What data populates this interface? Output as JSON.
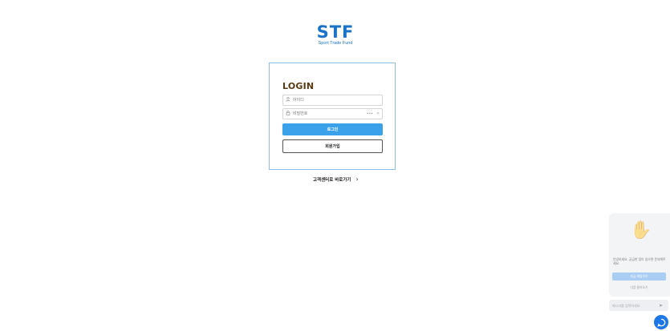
{
  "logo": {
    "mark": "STF",
    "subtitle": "Sport Trade Fund"
  },
  "login": {
    "title": "LOGIN",
    "id_placeholder": "아이디",
    "password_placeholder": "비밀번호",
    "password_toggle": "•••",
    "password_clear": "✕",
    "login_button": "로그인",
    "join_button": "회원가입"
  },
  "support_link": {
    "label": "고객센터로 바로가기",
    "chevron": "›"
  },
  "chat": {
    "hand_emoji": "✋",
    "message": "안녕하세요. 궁금한 점이 있으면 문의해주세요.",
    "primary_button": "지금 채팅하기",
    "secondary_button": "다음 들어오기",
    "input_placeholder": "메시지를 입력하세요",
    "send_icon": "➤"
  },
  "colors": {
    "brand": "#1a73c9",
    "primary_button": "#3aa1ea",
    "title": "#5a3a12",
    "fab": "#1e77e6"
  }
}
